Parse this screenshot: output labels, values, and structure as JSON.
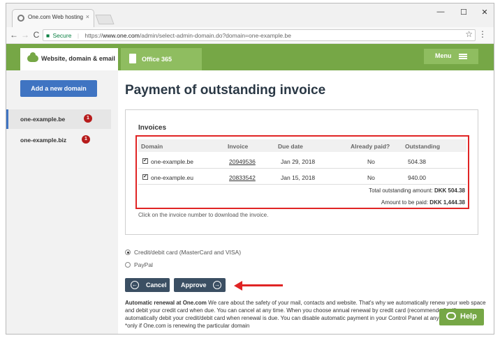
{
  "browser": {
    "tab_title": "One.com Web hosting",
    "tab_close": "×",
    "window_controls": {
      "minimize": "—",
      "maximize": "☐",
      "close": "✕"
    },
    "nav": {
      "back": "←",
      "forward": "→",
      "reload": "C"
    },
    "address": {
      "secure_label": "Secure",
      "url_scheme": "https://",
      "url_host": "www.one.com",
      "url_path": "/admin/select-admin-domain.do?domain=one-example.be"
    },
    "star": "☆",
    "menu": "⋮"
  },
  "topnav": {
    "active_tab": "Website, domain & email",
    "office_tab": "Office 365",
    "menu_label": "Menu"
  },
  "sidebar": {
    "add_button": "Add a new domain",
    "domains": [
      {
        "name": "one-example.be",
        "badge": "1"
      },
      {
        "name": "one-example.biz",
        "badge": "1"
      }
    ]
  },
  "main": {
    "title": "Payment of outstanding invoice",
    "invoices_heading": "Invoices",
    "columns": [
      "Domain",
      "Invoice",
      "Due date",
      "Already paid?",
      "Outstanding"
    ],
    "rows": [
      {
        "checked": "✔",
        "domain": "one-example.be",
        "invoice": "20949536",
        "due": "Jan 29, 2018",
        "paid": "No",
        "outstanding": "504.38"
      },
      {
        "checked": "✔",
        "domain": "one-example.eu",
        "invoice": "20833542",
        "due": "Jan 15, 2018",
        "paid": "No",
        "outstanding": "940.00"
      }
    ],
    "total_label": "Total outstanding amount:",
    "total_value": "DKK 504.38",
    "pay_label": "Amount to be paid:",
    "pay_value": "DKK 1,444.38",
    "click_note": "Click on the invoice number to download the invoice."
  },
  "payment": {
    "options": [
      "Credit/debit card (MasterCard and VISA)",
      "PayPal"
    ],
    "cancel_label": "Cancel",
    "approve_label": "Approve"
  },
  "renewal": {
    "heading": "Automatic renewal at One.com",
    "body": "We care about the safety of your mail, contacts and website. That's why we automatically renew your web space and debit your credit card when due. You can cancel at any time. When you choose annual renewal by credit card (recommended) will automatically debit your credit/debit card when renewal is due. You can disable automatic payment in your Control Panel at any time.",
    "footnote": "*only if One.com is renewing the particular domain"
  },
  "help": {
    "label": "Help"
  },
  "colors": {
    "brand_green": "#76a746",
    "blue_button": "#3f74c2",
    "dark_button": "#3b4f63",
    "highlight_red": "#e02424",
    "badge_red": "#b71c1c"
  }
}
